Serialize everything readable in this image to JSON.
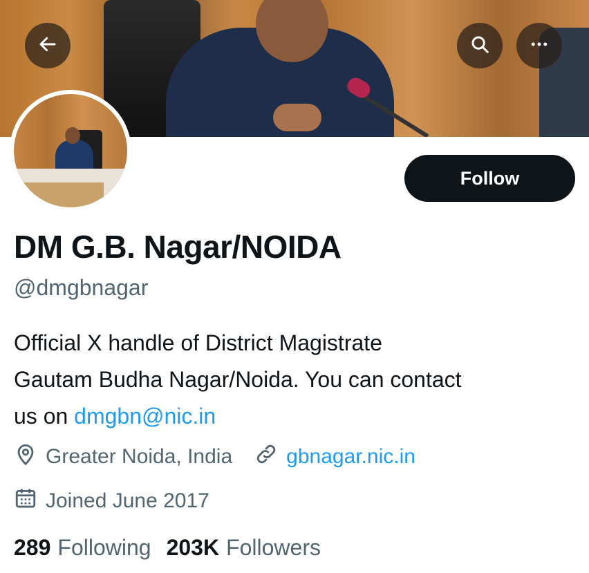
{
  "profile": {
    "display_name": "DM G.B. Nagar/NOIDA",
    "handle": "@dmgbnagar",
    "bio_line1": "Official X handle of District Magistrate",
    "bio_line2": "Gautam Budha Nagar/Noida. You can contact",
    "bio_line3_prefix": "us on ",
    "bio_email": "dmgbn@nic.in",
    "location": "Greater Noida, India",
    "website": "gbnagar.nic.in",
    "joined": "Joined June 2017"
  },
  "actions": {
    "follow_label": "Follow"
  },
  "stats": {
    "following_count": "289",
    "following_label": "Following",
    "followers_count": "203K",
    "followers_label": "Followers"
  },
  "icons": {
    "back": "back-arrow-icon",
    "search": "search-icon",
    "more": "more-icon",
    "location": "location-pin-icon",
    "link": "link-icon",
    "calendar": "calendar-icon"
  },
  "colors": {
    "text_primary": "#0f1419",
    "text_secondary": "#536471",
    "link": "#1d9bf0",
    "follow_bg": "#0f1419"
  }
}
